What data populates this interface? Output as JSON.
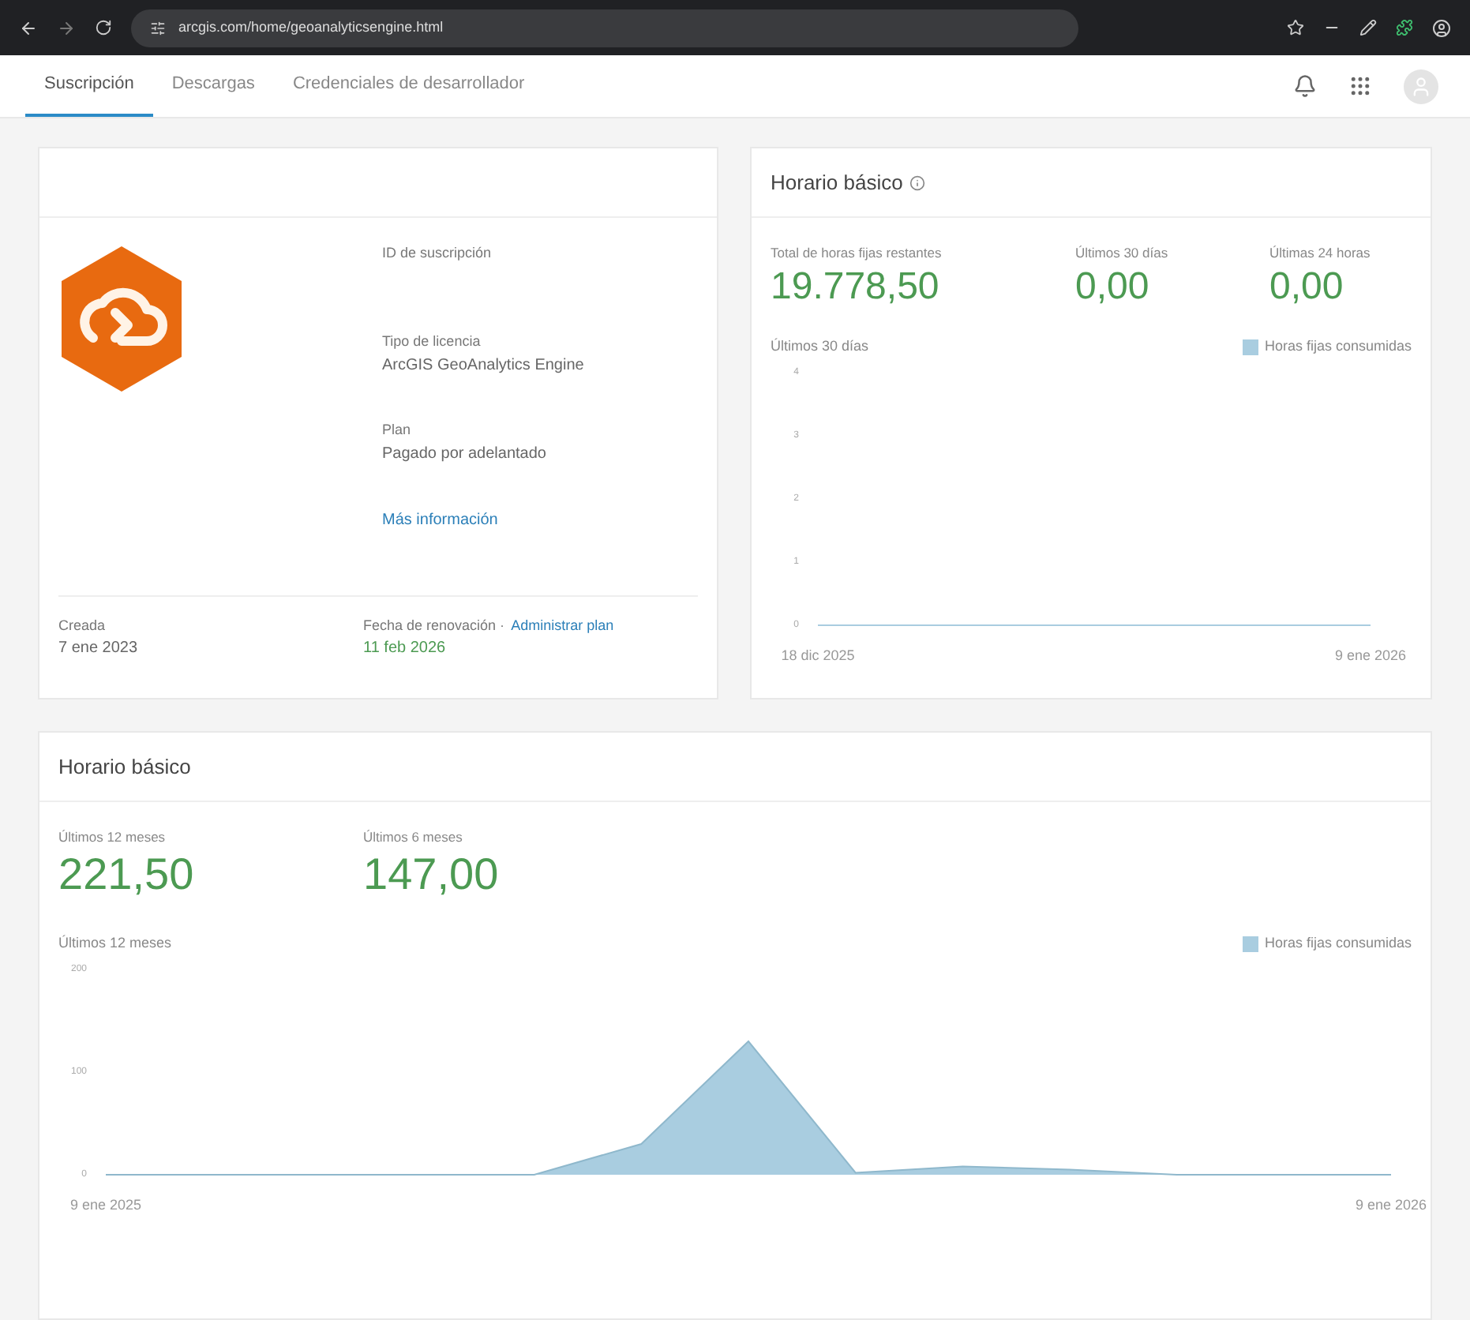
{
  "browser": {
    "url": "arcgis.com/home/geoanalyticsengine.html"
  },
  "tabs": [
    {
      "label": "Suscripción",
      "selected": true
    },
    {
      "label": "Descargas",
      "selected": false
    },
    {
      "label": "Credenciales de desarrollador",
      "selected": false
    }
  ],
  "subscription": {
    "fields": [
      {
        "label": "ID de suscripción"
      },
      {
        "label": "Tipo de licencia",
        "value": "ArcGIS GeoAnalytics Engine"
      },
      {
        "label": "Plan",
        "value": "Pagado por adelantado"
      }
    ],
    "more_link": "Más información",
    "created_label": "Creada",
    "created_value": "7 ene 2023",
    "renewal_label": "Fecha de renovación ·",
    "renewal_link": "Administrar plan",
    "renewal_value": "11 feb 2026"
  },
  "hours_card": {
    "title": "Horario básico",
    "stats": [
      {
        "label": "Total de horas fijas restantes",
        "value": "19.778,50"
      },
      {
        "label": "Últimos 30 días",
        "value": "0,00"
      },
      {
        "label": "Últimas 24 horas",
        "value": "0,00"
      }
    ],
    "chart_label": "Últimos 30 días",
    "chart_data": {
      "type": "line",
      "categories": [
        "18 dic 2025",
        null,
        null,
        null,
        null,
        null,
        null,
        null,
        null,
        null,
        null,
        null,
        null,
        null,
        null,
        null,
        null,
        null,
        null,
        null,
        null,
        null,
        "9 ene 2026"
      ],
      "series": [
        {
          "name": "Horas fijas consumidas",
          "color": "#a9cde0",
          "values": [
            0,
            0,
            0,
            0,
            0,
            0,
            0,
            0,
            0,
            0,
            0,
            0,
            0,
            0,
            0,
            0,
            0,
            0,
            0,
            0,
            0,
            0,
            0
          ]
        }
      ],
      "ylim": [
        0,
        4
      ],
      "yticks": [
        0,
        1,
        2,
        3,
        4
      ]
    }
  },
  "yearly_card": {
    "title": "Horario básico",
    "stats": [
      {
        "label": "Últimos 12 meses",
        "value": "221,50"
      },
      {
        "label": "Últimos 6 meses",
        "value": "147,00"
      }
    ],
    "chart_label": "Últimos 12 meses",
    "chart_data": {
      "type": "area",
      "categories": [
        "9 ene 2025",
        null,
        null,
        null,
        null,
        null,
        null,
        null,
        null,
        null,
        null,
        null,
        "9 ene 2026"
      ],
      "series": [
        {
          "name": "Horas fijas consumidas",
          "color": "#a9cde0",
          "values": [
            0,
            0,
            0,
            0,
            0,
            30,
            130,
            2,
            8,
            5,
            0,
            0,
            0
          ]
        }
      ],
      "ylim": [
        0,
        200
      ],
      "yticks": [
        0,
        100,
        200
      ]
    }
  }
}
